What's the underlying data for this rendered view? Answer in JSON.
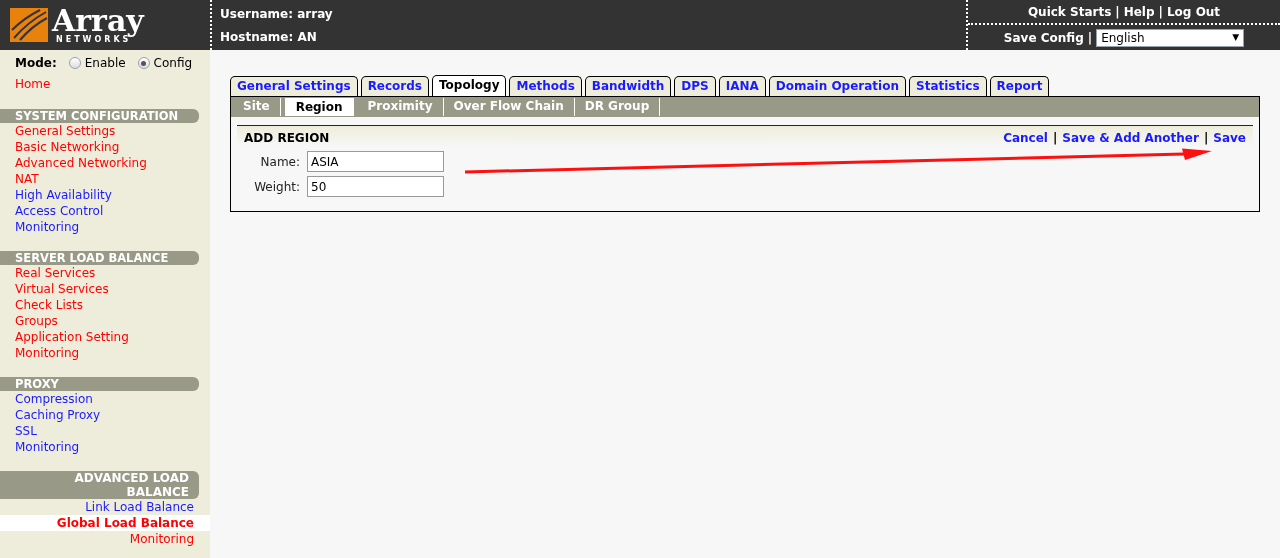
{
  "logo": {
    "name": "Array",
    "sub": "NETWORKS"
  },
  "header": {
    "username": "Username: array",
    "hostname": "Hostname: AN",
    "links": [
      "Quick Starts",
      "Help",
      "Log Out"
    ],
    "separator": "|",
    "save_config": "Save Config",
    "language": "English",
    "dropdown_caret": "▼"
  },
  "mode": {
    "label": "Mode:",
    "options": [
      {
        "label": "Enable",
        "selected": false
      },
      {
        "label": "Config",
        "selected": true
      }
    ]
  },
  "home": {
    "label": "Home",
    "color": "#ff0000"
  },
  "sidebar": [
    {
      "title": "SYSTEM CONFIGURATION",
      "kind": "left",
      "items": [
        {
          "label": "General Settings",
          "color": "#ff0000",
          "selected": false
        },
        {
          "label": "Basic Networking",
          "color": "#ff0000",
          "selected": false
        },
        {
          "label": "Advanced Networking",
          "color": "#ff0000",
          "selected": false
        },
        {
          "label": "NAT",
          "color": "#ff0000",
          "selected": false
        },
        {
          "label": "High Availability",
          "color": "#1a1aff",
          "selected": false
        },
        {
          "label": "Access Control",
          "color": "#1a1aff",
          "selected": false
        },
        {
          "label": "Monitoring",
          "color": "#1a1aff",
          "selected": false
        }
      ]
    },
    {
      "title": "SERVER LOAD BALANCE",
      "kind": "left",
      "items": [
        {
          "label": "Real Services",
          "color": "#ff0000",
          "selected": false
        },
        {
          "label": "Virtual Services",
          "color": "#ff0000",
          "selected": false
        },
        {
          "label": "Check Lists",
          "color": "#ff0000",
          "selected": false
        },
        {
          "label": "Groups",
          "color": "#ff0000",
          "selected": false
        },
        {
          "label": "Application Setting",
          "color": "#ff0000",
          "selected": false
        },
        {
          "label": "Monitoring",
          "color": "#ff0000",
          "selected": false
        }
      ]
    },
    {
      "title": "PROXY",
      "kind": "left",
      "items": [
        {
          "label": "Compression",
          "color": "#1a1aff",
          "selected": false
        },
        {
          "label": "Caching Proxy",
          "color": "#1a1aff",
          "selected": false
        },
        {
          "label": "SSL",
          "color": "#1a1aff",
          "selected": false
        },
        {
          "label": "Monitoring",
          "color": "#1a1aff",
          "selected": false
        }
      ]
    },
    {
      "title": "ADVANCED LOAD BALANCE",
      "kind": "right",
      "items": [
        {
          "label": "Link Load Balance",
          "color": "#1a1aff",
          "selected": false
        },
        {
          "label": "Global Load Balance",
          "color": "#ff0000",
          "selected": true
        },
        {
          "label": "Monitoring",
          "color": "#ff0000",
          "selected": false
        }
      ]
    }
  ],
  "tabs": [
    {
      "label": "General Settings",
      "selected": false
    },
    {
      "label": "Records",
      "selected": false
    },
    {
      "label": "Topology",
      "selected": true
    },
    {
      "label": "Methods",
      "selected": false
    },
    {
      "label": "Bandwidth",
      "selected": false
    },
    {
      "label": "DPS",
      "selected": false
    },
    {
      "label": "IANA",
      "selected": false
    },
    {
      "label": "Domain Operation",
      "selected": false
    },
    {
      "label": "Statistics",
      "selected": false
    },
    {
      "label": "Report",
      "selected": false
    }
  ],
  "subtabs": [
    {
      "label": "Site",
      "selected": false
    },
    {
      "label": "Region",
      "selected": true
    },
    {
      "label": "Proximity",
      "selected": false
    },
    {
      "label": "Over Flow Chain",
      "selected": false
    },
    {
      "label": "DR Group",
      "selected": false
    }
  ],
  "form": {
    "title": "ADD REGION",
    "separator": "|",
    "actions": [
      "Cancel",
      "Save & Add Another",
      "Save"
    ],
    "fields": [
      {
        "label": "Name:",
        "value": "ASIA"
      },
      {
        "label": "Weight:",
        "value": "50"
      }
    ]
  },
  "annotation": {
    "kind": "arrow"
  }
}
